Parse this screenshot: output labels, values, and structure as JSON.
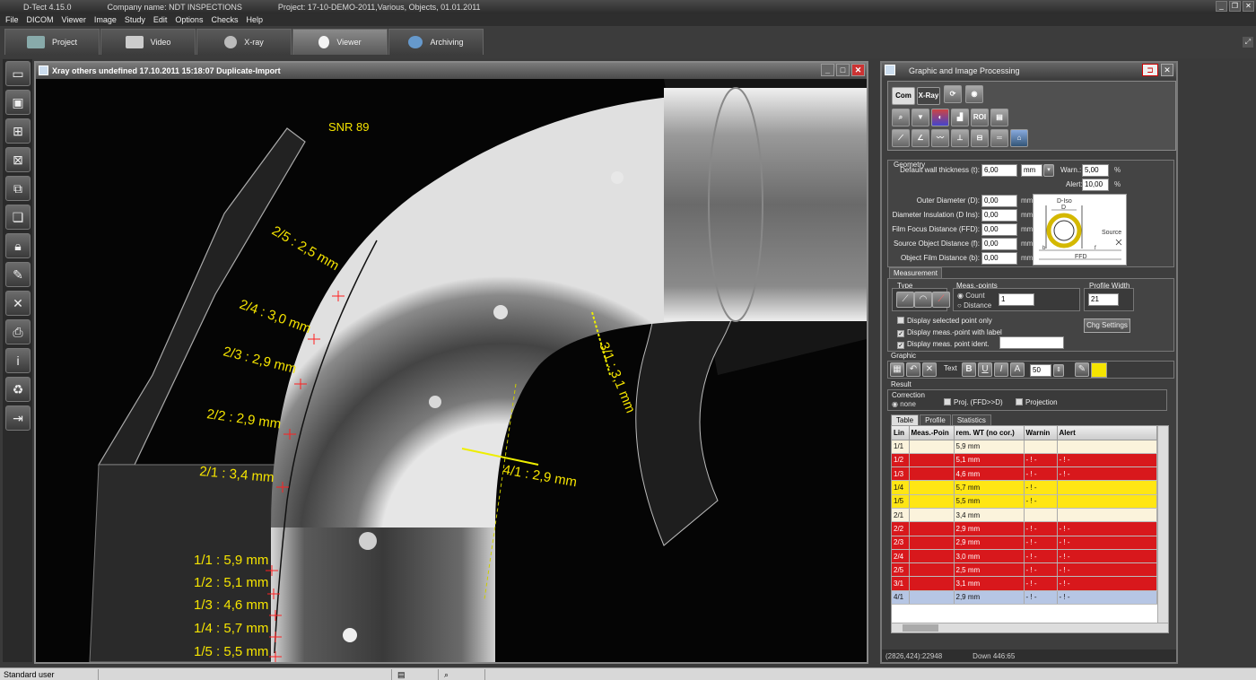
{
  "app": {
    "title": "D-Tect 4.15.0",
    "company": "Company name: NDT INSPECTIONS",
    "project": "Project: 17-10-DEMO-2011,Various, Objects, 01.01.2011"
  },
  "menu": [
    "File",
    "DICOM",
    "Viewer",
    "Image",
    "Study",
    "Edit",
    "Options",
    "Checks",
    "Help"
  ],
  "modules": [
    {
      "label": "Project"
    },
    {
      "label": "Video"
    },
    {
      "label": "X-ray"
    },
    {
      "label": "Viewer"
    },
    {
      "label": "Archiving"
    }
  ],
  "viewer": {
    "title": "Xray others undefined 17.10.2011 15:18:07 Duplicate-Import",
    "snr": "SNR 89",
    "labels": [
      "2/5 : 2,5 mm",
      "2/4 : 3,0 mm",
      "2/3 : 2,9 mm",
      "2/2 : 2,9 mm",
      "2/1 : 3,4 mm",
      "1/1 : 5,9 mm",
      "1/2 : 5,1 mm",
      "1/3 : 4,6 mm",
      "1/4 : 5,7 mm",
      "1/5 : 5,5 mm",
      "3/1 : 3,1 mm",
      "4/1 : 2,9 mm"
    ]
  },
  "panel": {
    "title": "Graphic and Image Processing",
    "tool_tabs": [
      "Com",
      "X-Ray"
    ],
    "roi_label": "ROI",
    "geometry": {
      "title": "Geometry",
      "default_wall_label": "Default wall thickness (t):",
      "default_wall_value": "6,00",
      "unit_select": "mm",
      "warn_label": "Warn.:",
      "warn_value": "5,00",
      "alert_label": "Alert:",
      "alert_value": "10,00",
      "percent": "%",
      "fields": [
        {
          "label": "Outer Diameter (D):",
          "value": "0,00",
          "unit": "mm"
        },
        {
          "label": "Diameter Insulation (D Ins):",
          "value": "0,00",
          "unit": "mm"
        },
        {
          "label": "Film Focus Distance (FFD):",
          "value": "0,00",
          "unit": "mm"
        },
        {
          "label": "Source Object Distance (f):",
          "value": "0,00",
          "unit": "mm"
        },
        {
          "label": "Object Film Distance (b):",
          "value": "0,00",
          "unit": "mm"
        }
      ],
      "diagram": {
        "d_iso": "D-Iso",
        "d": "D",
        "source": "Source",
        "b": "b",
        "f": "f",
        "ffd": "FFD"
      }
    },
    "measurement": {
      "title": "Measurement",
      "type_label": "Type",
      "meas_points_label": "Meas.-points",
      "count_label": "Count",
      "distance_label": "Distance",
      "count_value": "1",
      "profile_width_label": "Profile Width",
      "profile_width_value": "21",
      "opt_selected": "Display selected point only",
      "opt_label": "Display meas.-point with label",
      "opt_ident": "Display meas. point ident.",
      "chg_settings": "Chg Settings"
    },
    "graphic": {
      "title": "Graphic",
      "text_label": "Text",
      "font_size": "50",
      "color": "#f5e400"
    },
    "result": {
      "title": "Result",
      "correction_label": "Correction",
      "opt_none": "none",
      "opt_proj": "Proj. (FFD>>D)",
      "opt_projection": "Projection"
    },
    "subtabs": [
      "Table",
      "Profile",
      "Statistics"
    ],
    "table": {
      "headers": [
        "Lin",
        "Meas.-Poin",
        "rem. WT (no cor.)",
        "Warnin",
        "Alert"
      ],
      "rows": [
        {
          "lin": "1/1",
          "rem": "5,9 mm",
          "warn": "",
          "alert": "",
          "state": "cream"
        },
        {
          "lin": "1/2",
          "rem": "5,1 mm",
          "warn": "- ! -",
          "alert": "- ! -",
          "state": "red"
        },
        {
          "lin": "1/3",
          "rem": "4,6 mm",
          "warn": "- ! -",
          "alert": "- ! -",
          "state": "red"
        },
        {
          "lin": "1/4",
          "rem": "5,7 mm",
          "warn": "- ! -",
          "alert": "",
          "state": "yellow"
        },
        {
          "lin": "1/5",
          "rem": "5,5 mm",
          "warn": "- ! -",
          "alert": "",
          "state": "yellow"
        },
        {
          "lin": "2/1",
          "rem": "3,4 mm",
          "warn": "",
          "alert": "",
          "state": "cream"
        },
        {
          "lin": "2/2",
          "rem": "2,9 mm",
          "warn": "- ! -",
          "alert": "- ! -",
          "state": "red"
        },
        {
          "lin": "2/3",
          "rem": "2,9 mm",
          "warn": "- ! -",
          "alert": "- ! -",
          "state": "red"
        },
        {
          "lin": "2/4",
          "rem": "3,0 mm",
          "warn": "- ! -",
          "alert": "- ! -",
          "state": "red"
        },
        {
          "lin": "2/5",
          "rem": "2,5 mm",
          "warn": "- ! -",
          "alert": "- ! -",
          "state": "red"
        },
        {
          "lin": "3/1",
          "rem": "3,1 mm",
          "warn": "- ! -",
          "alert": "- ! -",
          "state": "red"
        },
        {
          "lin": "4/1",
          "rem": "2,9 mm",
          "warn": "- ! -",
          "alert": "- ! -",
          "state": "blue"
        }
      ]
    },
    "status_coords": "(2826,424):22948",
    "status_down": "Down 446:65"
  },
  "statusbar": {
    "user": "Standard user"
  }
}
